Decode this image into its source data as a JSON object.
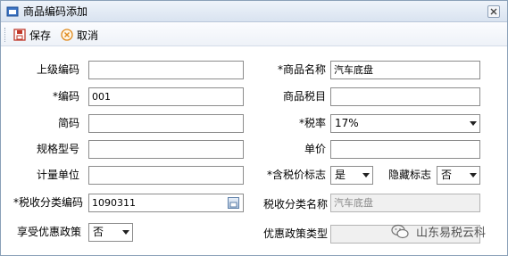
{
  "window": {
    "title": "商品编码添加"
  },
  "toolbar": {
    "save_label": "保存",
    "cancel_label": "取消"
  },
  "form": {
    "parent_code": {
      "label": "上级编码",
      "value": ""
    },
    "code": {
      "label": "*编码",
      "value": "001"
    },
    "short_code": {
      "label": "简码",
      "value": ""
    },
    "spec_model": {
      "label": "规格型号",
      "value": ""
    },
    "unit_of_measure": {
      "label": "计量单位",
      "value": ""
    },
    "tax_category_code": {
      "label": "*税收分类编码",
      "value": "1090311"
    },
    "preferential_policy": {
      "label": "享受优惠政策",
      "value": "否"
    },
    "product_name": {
      "label": "*商品名称",
      "value": "汽车底盘"
    },
    "product_tax_item": {
      "label": "商品税目",
      "value": ""
    },
    "tax_rate": {
      "label": "*税率",
      "value": "17%"
    },
    "unit_price": {
      "label": "单价",
      "value": ""
    },
    "tax_included_flag": {
      "label": "*含税价标志",
      "value": "是"
    },
    "hidden_flag": {
      "label": "隐藏标志",
      "value": "否"
    },
    "tax_category_name": {
      "label": "税收分类名称",
      "value": "汽车底盘"
    },
    "preferential_policy_type": {
      "label": "优惠政策类型",
      "value": ""
    }
  },
  "watermark": {
    "text": "山东易税云科"
  },
  "icons": {
    "app": "app-window-icon",
    "save": "save-icon",
    "cancel": "cancel-icon",
    "close": "close-icon",
    "picker": "picker-icon",
    "wechat": "wechat-icon"
  },
  "colors": {
    "titlebar": "#d9e3f0",
    "save_icon": "#c0392b",
    "cancel_icon": "#e08a1e",
    "disabled_field": "#f0f0f0"
  }
}
